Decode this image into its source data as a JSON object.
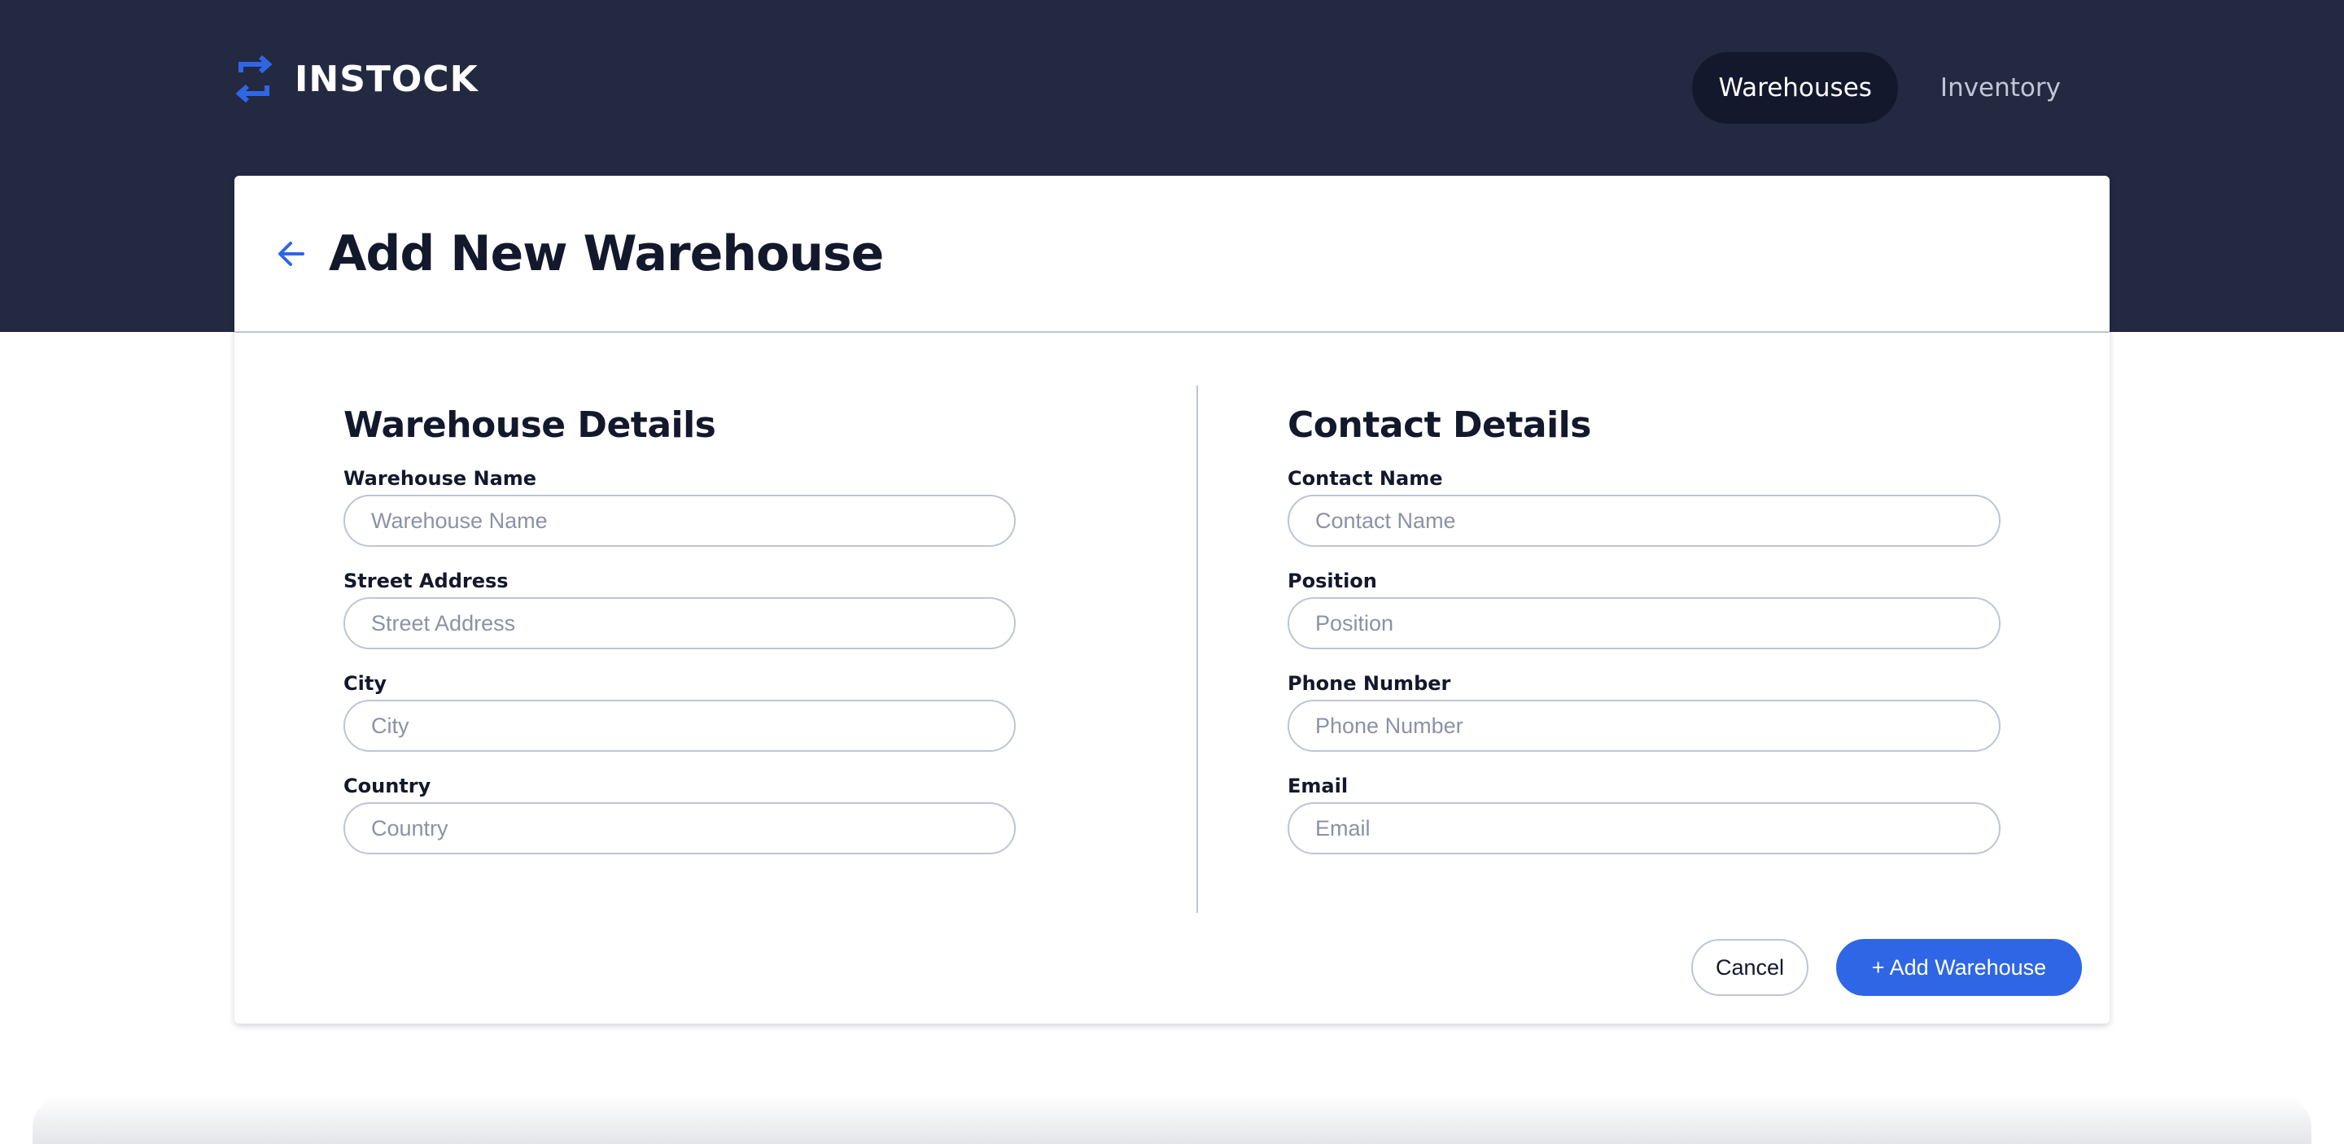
{
  "brand": {
    "name": "INSTOCK",
    "logo_icon": "swap-arrows-icon",
    "accent_color": "#2e66e5"
  },
  "nav": {
    "items": [
      {
        "label": "Warehouses",
        "active": true
      },
      {
        "label": "Inventory",
        "active": false
      }
    ]
  },
  "page": {
    "title": "Add New Warehouse",
    "back_icon": "arrow-left-icon"
  },
  "warehouse_details": {
    "title": "Warehouse Details",
    "fields": [
      {
        "label": "Warehouse Name",
        "placeholder": "Warehouse Name",
        "value": ""
      },
      {
        "label": "Street Address",
        "placeholder": "Street Address",
        "value": ""
      },
      {
        "label": "City",
        "placeholder": "City",
        "value": ""
      },
      {
        "label": "Country",
        "placeholder": "Country",
        "value": ""
      }
    ]
  },
  "contact_details": {
    "title": "Contact Details",
    "fields": [
      {
        "label": "Contact Name",
        "placeholder": "Contact Name",
        "value": ""
      },
      {
        "label": "Position",
        "placeholder": "Position",
        "value": ""
      },
      {
        "label": "Phone Number",
        "placeholder": "Phone Number",
        "value": ""
      },
      {
        "label": "Email",
        "placeholder": "Email",
        "value": ""
      }
    ]
  },
  "actions": {
    "cancel_label": "Cancel",
    "submit_label": "+ Add Warehouse"
  },
  "colors": {
    "header_bg": "#232940",
    "active_nav_bg": "#13182c",
    "text_dark": "#13182c",
    "border": "#bdc5d5"
  }
}
